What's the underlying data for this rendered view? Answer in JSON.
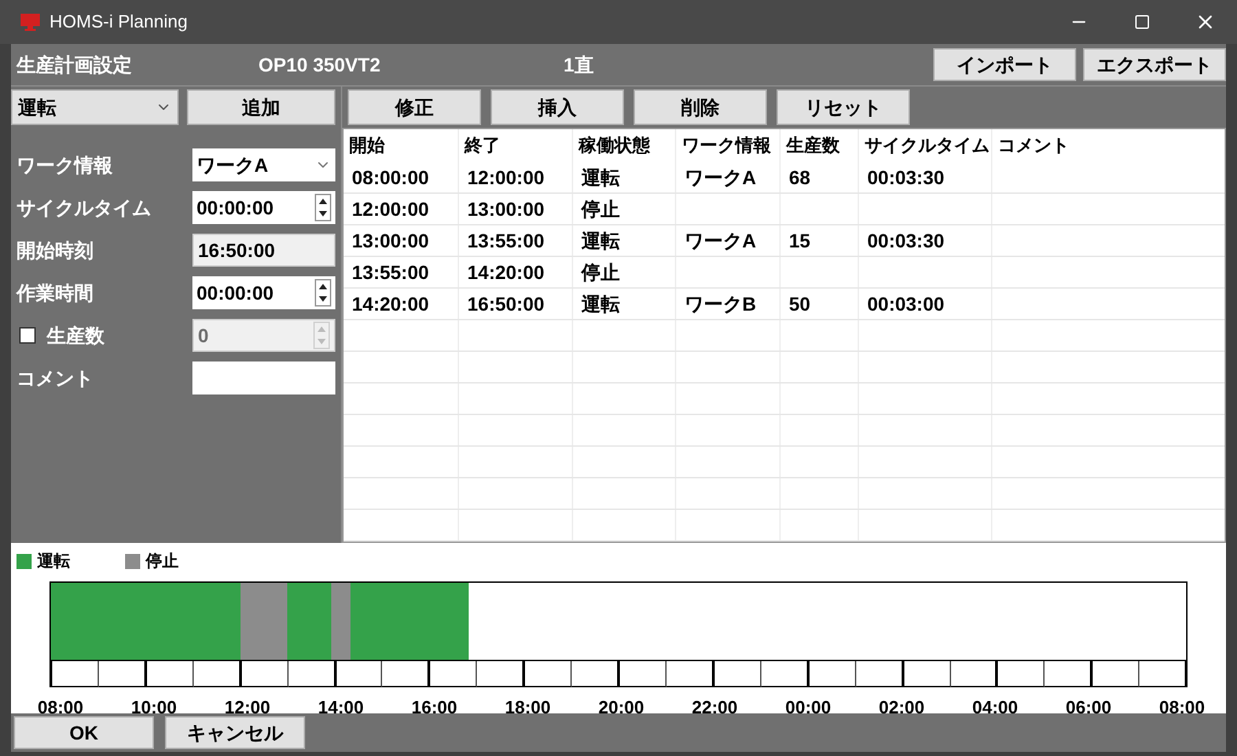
{
  "window": {
    "title": "HOMS-i Planning"
  },
  "header": {
    "title": "生産計画設定",
    "machine": "OP10 350VT2",
    "shift": "1直",
    "buttons": [
      "インポート",
      "エクスポート"
    ]
  },
  "mode_select": {
    "value": "運転"
  },
  "add_button": "追加",
  "toolbar": [
    "修正",
    "挿入",
    "削除",
    "リセット"
  ],
  "form": [
    {
      "kind": "select",
      "label": "ワーク情報",
      "value": "ワークA"
    },
    {
      "kind": "spin",
      "label": "サイクルタイム",
      "value": "00:00:00",
      "disabled": false
    },
    {
      "kind": "readonly",
      "label": "開始時刻",
      "value": "16:50:00"
    },
    {
      "kind": "spin",
      "label": "作業時間",
      "value": "00:00:00",
      "disabled": false
    },
    {
      "kind": "checkspin",
      "label": "生産数",
      "checked": false,
      "value": "0",
      "disabled": true
    },
    {
      "kind": "text",
      "label": "コメント"
    }
  ],
  "table": {
    "columns": [
      "開始",
      "終了",
      "稼働状態",
      "ワーク情報",
      "生産数",
      "サイクルタイム",
      "コメント"
    ],
    "rows": [
      {
        "kind": "run",
        "cells": [
          "08:00:00",
          "12:00:00",
          "運転",
          "ワークA",
          "68",
          "00:03:30"
        ]
      },
      {
        "kind": "stop",
        "cells": [
          "12:00:00",
          "13:00:00",
          "停止"
        ]
      },
      {
        "kind": "run",
        "cells": [
          "13:00:00",
          "13:55:00",
          "運転",
          "ワークA",
          "15",
          "00:03:30"
        ]
      },
      {
        "kind": "stop",
        "cells": [
          "13:55:00",
          "14:20:00",
          "停止"
        ]
      },
      {
        "kind": "run",
        "cells": [
          "14:20:00",
          "16:50:00",
          "運転",
          "ワークB",
          "50",
          "00:03:00"
        ]
      }
    ]
  },
  "legend": [
    {
      "kind": "run",
      "label": "運転",
      "color": "#34a24a"
    },
    {
      "kind": "stop",
      "label": "停止",
      "color": "#8c8c8c"
    }
  ],
  "timeline": {
    "labels": [
      "08:00",
      "10:00",
      "12:00",
      "14:00",
      "16:00",
      "18:00",
      "20:00",
      "22:00",
      "00:00",
      "02:00",
      "04:00",
      "06:00",
      "08:00"
    ]
  },
  "footer": {
    "buttons": [
      "OK",
      "キャンセル"
    ]
  }
}
